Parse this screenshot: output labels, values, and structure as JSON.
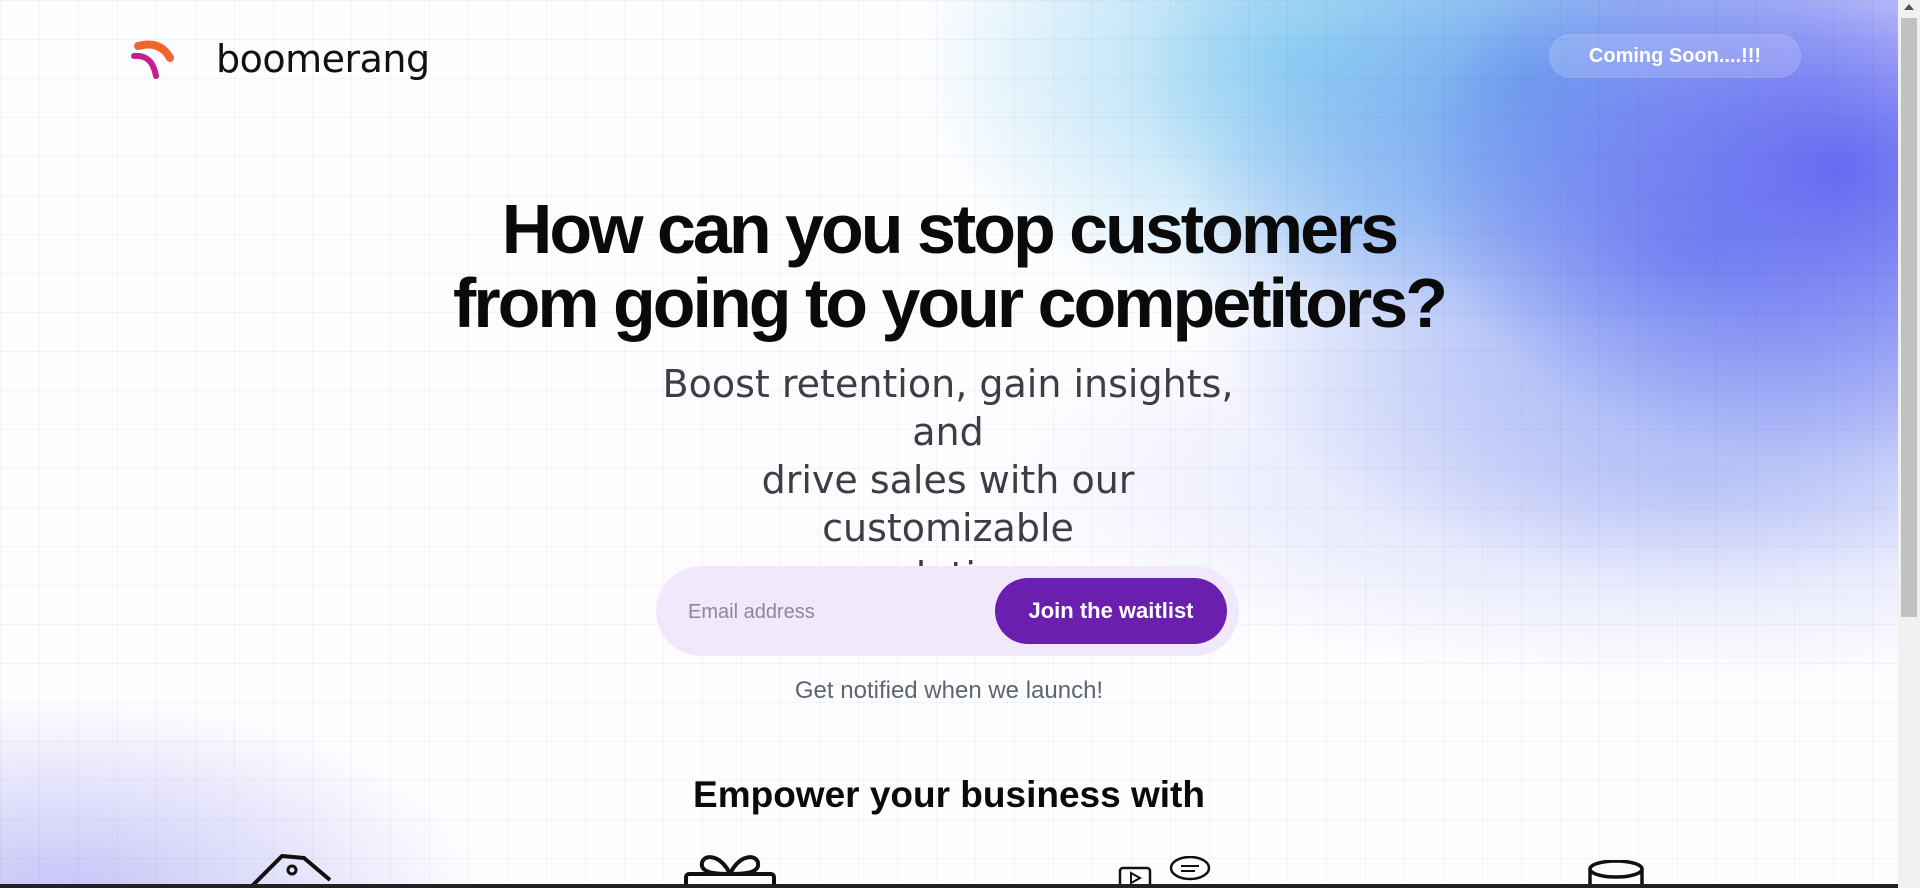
{
  "header": {
    "logo_text": "boomerang",
    "coming_soon_label": "Coming Soon....!!!"
  },
  "hero": {
    "title_line1": "How can you stop customers",
    "title_line2": "from going to your competitors?",
    "subtitle_line1": "Boost retention, gain insights, and",
    "subtitle_line2": "drive sales with our customizable",
    "subtitle_line3": "solution"
  },
  "signup": {
    "email_placeholder": "Email address",
    "email_value": "",
    "join_label": "Join the waitlist",
    "notify_text": "Get notified when we launch!"
  },
  "features": {
    "section_title": "Empower your business with",
    "icons": [
      "price-tag-icon",
      "gift-icon",
      "video-chat-icon",
      "coins-icon"
    ]
  },
  "colors": {
    "accent": "#6a1fae",
    "logo_orange": "#f0652f",
    "logo_magenta": "#c81e8c",
    "gradient_blue": "#6366f1"
  }
}
